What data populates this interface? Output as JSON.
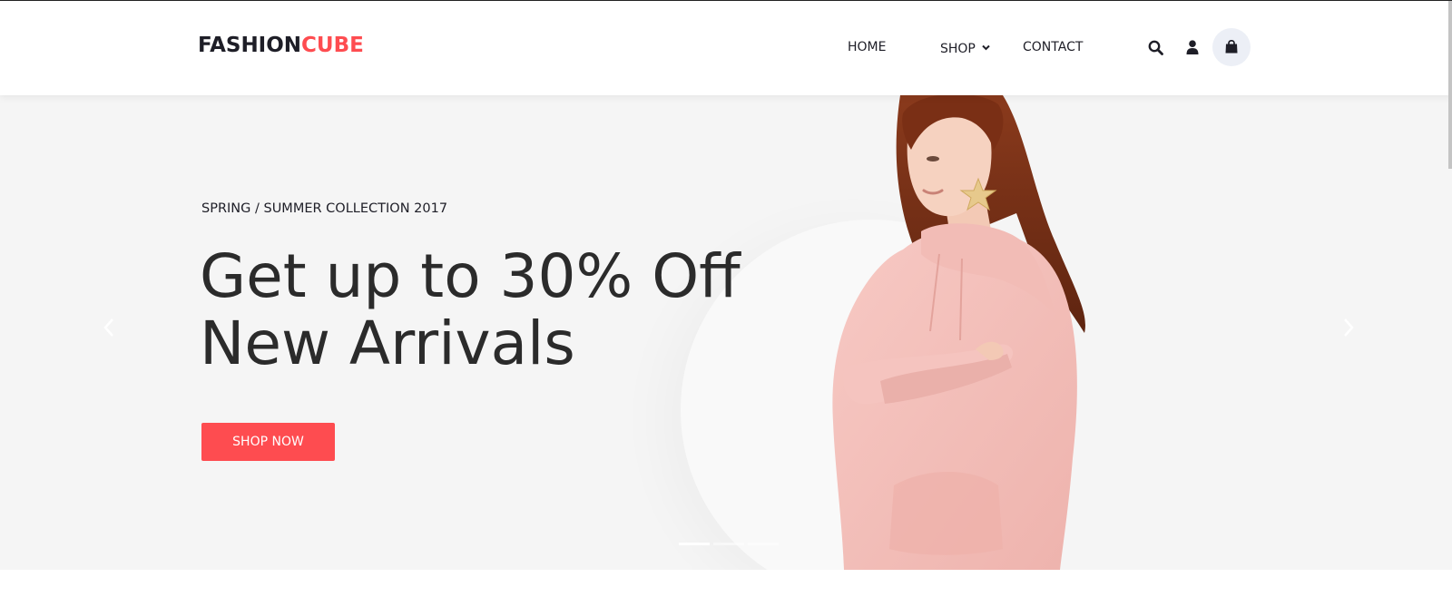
{
  "brand": {
    "part1": "FASHION",
    "part2": "CUBE",
    "color_dark": "#1e1e27",
    "color_accent": "#fe4c50"
  },
  "nav": {
    "home": "HOME",
    "shop": "SHOP",
    "contact": "CONTACT"
  },
  "header_icons": [
    "search-icon",
    "user-icon",
    "shopping-bag-icon"
  ],
  "hero": {
    "kicker": "SPRING / SUMMER COLLECTION 2017",
    "headline_line1": "Get up to 30% Off",
    "headline_line2": "New Arrivals",
    "cta_label": "SHOP NOW",
    "cta_color": "#fe4c50",
    "background": "#f5f5f5",
    "image": "woman-in-pink-hoodie",
    "slides": 3,
    "active_slide": 1
  }
}
